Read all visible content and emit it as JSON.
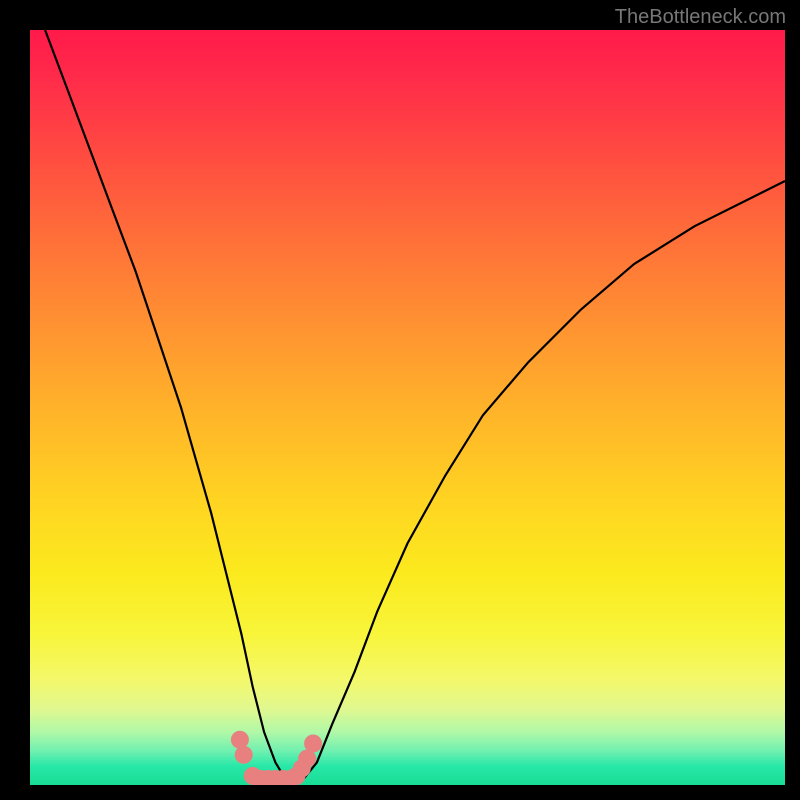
{
  "watermark": "TheBottleneck.com",
  "chart_data": {
    "type": "line",
    "title": "",
    "xlabel": "",
    "ylabel": "",
    "xlim": [
      0,
      100
    ],
    "ylim": [
      0,
      100
    ],
    "series": [
      {
        "name": "bottleneck-curve",
        "x": [
          2,
          5,
          8,
          11,
          14,
          17,
          20,
          22,
          24,
          26,
          28,
          29.5,
          31,
          32.5,
          34,
          36,
          38,
          40,
          43,
          46,
          50,
          55,
          60,
          66,
          73,
          80,
          88,
          96,
          100
        ],
        "y": [
          100,
          92,
          84,
          76,
          68,
          59,
          50,
          43,
          36,
          28,
          20,
          13,
          7,
          3,
          0.5,
          0.5,
          3,
          8,
          15,
          23,
          32,
          41,
          49,
          56,
          63,
          69,
          74,
          78,
          80
        ]
      }
    ],
    "markers": {
      "name": "highlight-dots",
      "color": "#e88080",
      "points": [
        {
          "x": 27.8,
          "y": 6
        },
        {
          "x": 28.3,
          "y": 4
        },
        {
          "x": 29.5,
          "y": 1.2
        },
        {
          "x": 30.5,
          "y": 0.8
        },
        {
          "x": 31.5,
          "y": 0.8
        },
        {
          "x": 32.5,
          "y": 0.8
        },
        {
          "x": 33.5,
          "y": 0.8
        },
        {
          "x": 34.5,
          "y": 0.8
        },
        {
          "x": 35.3,
          "y": 1.2
        },
        {
          "x": 36.0,
          "y": 2.2
        },
        {
          "x": 36.7,
          "y": 3.5
        },
        {
          "x": 37.5,
          "y": 5.5
        }
      ]
    },
    "gradient_stops": [
      {
        "pos": 0,
        "color": "#ff1a4a"
      },
      {
        "pos": 0.5,
        "color": "#ffb22a"
      },
      {
        "pos": 0.8,
        "color": "#f8f53a"
      },
      {
        "pos": 1.0,
        "color": "#18dd94"
      }
    ]
  }
}
